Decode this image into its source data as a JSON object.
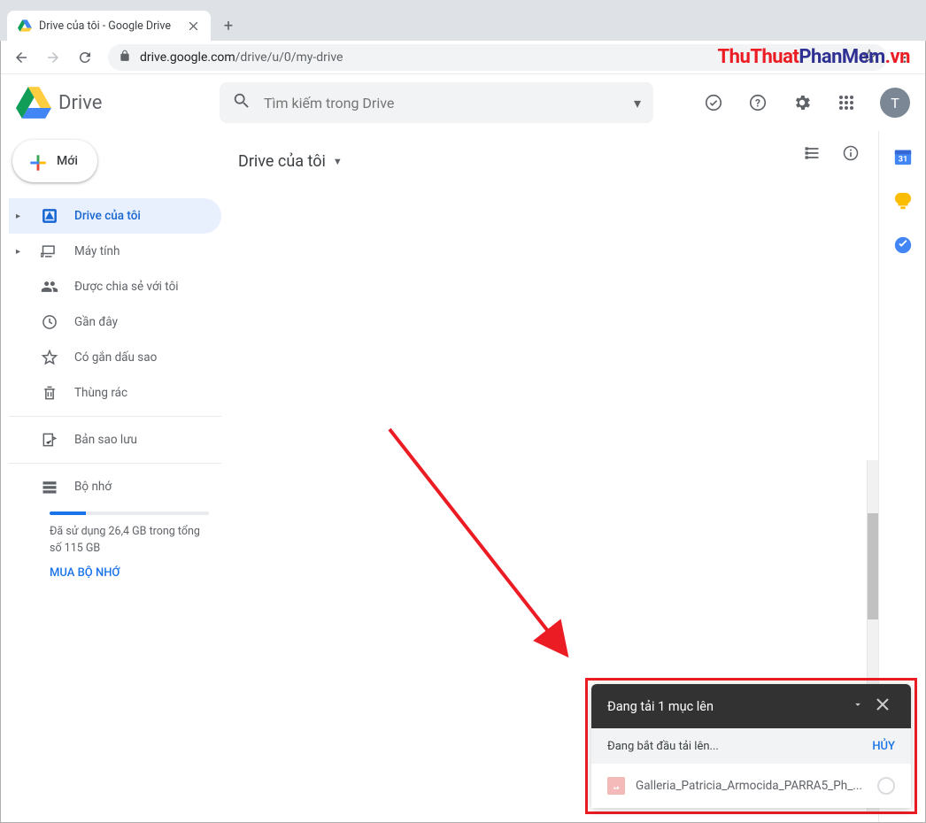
{
  "window": {
    "tab_title": "Drive của tôi - Google Drive",
    "url_domain": "drive.google.com",
    "url_path": "/drive/u/0/my-drive"
  },
  "watermark": {
    "part1": "ThuThuat",
    "part2": "PhanMem",
    "part3": ".vn"
  },
  "drive": {
    "product_name": "Drive",
    "search_placeholder": "Tìm kiếm trong Drive",
    "avatar_initial": "T"
  },
  "sidebar": {
    "new_label": "Mới",
    "items": [
      {
        "label": "Drive của tôi",
        "active": true,
        "expandable": true
      },
      {
        "label": "Máy tính",
        "active": false,
        "expandable": true
      },
      {
        "label": "Được chia sẻ với tôi",
        "active": false,
        "expandable": false
      },
      {
        "label": "Gần đây",
        "active": false,
        "expandable": false
      },
      {
        "label": "Có gắn dấu sao",
        "active": false,
        "expandable": false
      },
      {
        "label": "Thùng rác",
        "active": false,
        "expandable": false
      }
    ],
    "backup_label": "Bản sao lưu",
    "storage_label": "Bộ nhớ",
    "storage_text": "Đã sử dụng 26,4 GB trong tổng số 115 GB",
    "storage_buy": "MUA BỘ NHỚ"
  },
  "main": {
    "breadcrumb": "Drive của tôi"
  },
  "toast": {
    "title": "Đang tải 1 mục lên",
    "subtitle": "Đang bắt đầu tải lên...",
    "cancel": "HỦY",
    "file_name": "Galleria_Patricia_Armocida_PARRA5_Ph_..."
  }
}
